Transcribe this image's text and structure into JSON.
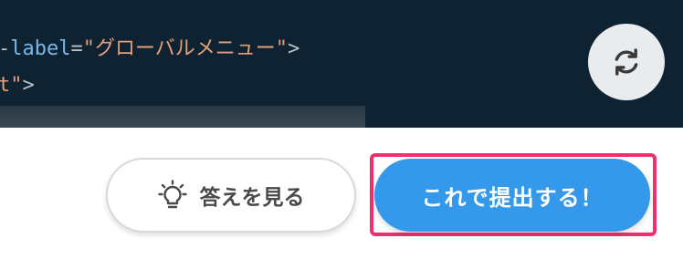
{
  "editor": {
    "line1": {
      "prefix": "-",
      "attr": "label",
      "equals": "=",
      "open_quote": "\"",
      "value": "グローバルメニュー",
      "close_quote": "\"",
      "end": ">"
    },
    "line2": {
      "tail": "t",
      "quote": "\"",
      "end": ">"
    }
  },
  "controls": {
    "refresh_icon": "refresh-icon",
    "answer_button": {
      "icon": "lightbulb-icon",
      "label": "答えを見る"
    },
    "submit_button": {
      "label": "これで提出する！"
    },
    "highlight_color": "#f0306e",
    "accent_color": "#3499ea"
  }
}
